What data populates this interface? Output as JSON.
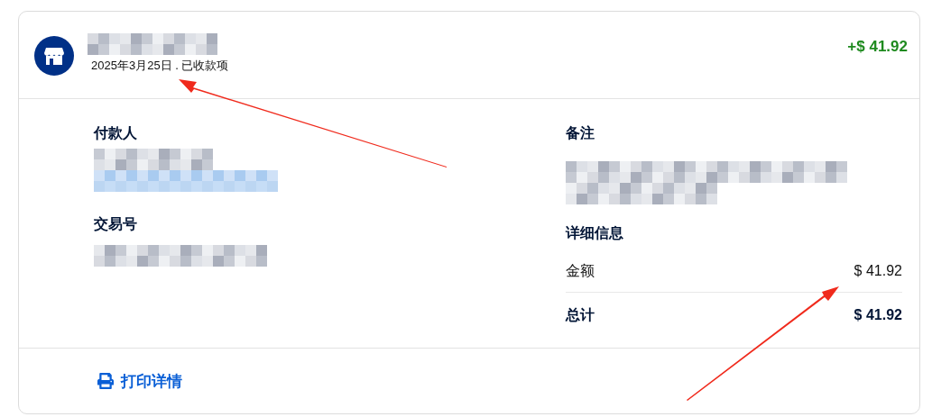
{
  "header": {
    "date_status": "2025年3月25日 . 已收款项",
    "amount": "+$ 41.92"
  },
  "payer": {
    "label": "付款人"
  },
  "transaction": {
    "label": "交易号"
  },
  "note": {
    "label": "备注"
  },
  "details": {
    "title": "详细信息",
    "rows": [
      {
        "kind": "line",
        "label": "金额",
        "value": "$ 41.92"
      },
      {
        "kind": "total",
        "label": "总计",
        "value": "$ 41.92"
      }
    ]
  },
  "footer": {
    "print_link": "打印详情"
  }
}
